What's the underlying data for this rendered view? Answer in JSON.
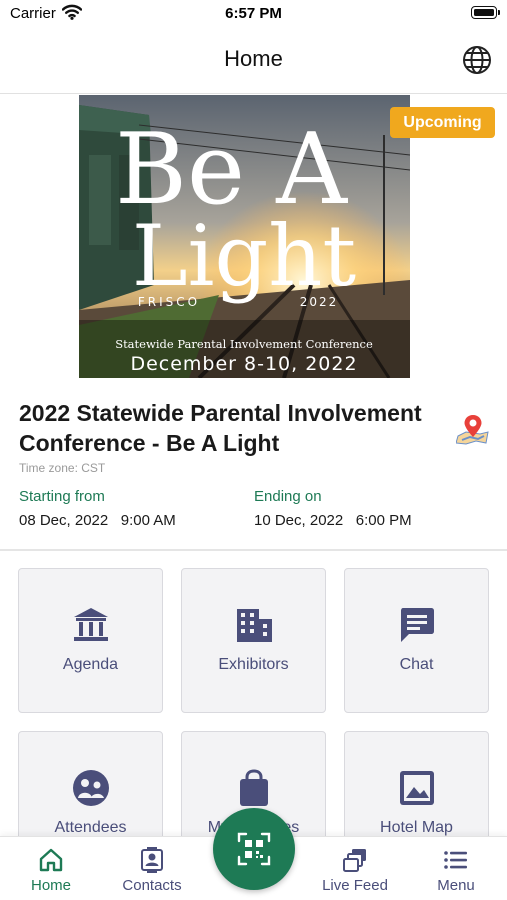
{
  "status_bar": {
    "carrier": "Carrier",
    "time": "6:57 PM"
  },
  "nav": {
    "title": "Home",
    "globe_icon": "globe-icon"
  },
  "banner": {
    "word1": "Be A",
    "word2": "Light",
    "city": "FRISCO",
    "year": "2022",
    "subtitle": "Statewide Parental Involvement Conference",
    "dates": "December 8-10, 2022"
  },
  "badge": "Upcoming",
  "event": {
    "title": "2022 Statewide Parental Involvement Conference - Be A Light",
    "timezone": "Time zone: CST",
    "start_label": "Starting from",
    "start_value": "08 Dec, 2022   9:00 AM",
    "end_label": "Ending on",
    "end_value": "10 Dec, 2022   6:00 PM"
  },
  "tiles": [
    {
      "label": "Agenda",
      "icon": "bank-icon"
    },
    {
      "label": "Exhibitors",
      "icon": "building-icon"
    },
    {
      "label": "Chat",
      "icon": "chat-icon"
    },
    {
      "label": "Attendees",
      "icon": "attendees-icon"
    },
    {
      "label": "My Favorites",
      "icon": "bag-icon"
    },
    {
      "label": "Hotel Map",
      "icon": "image-icon"
    }
  ],
  "tabs": [
    {
      "label": "Home",
      "icon": "home-icon"
    },
    {
      "label": "Contacts",
      "icon": "contacts-icon"
    },
    {
      "label": "Live Feed",
      "icon": "live-feed-icon"
    },
    {
      "label": "Menu",
      "icon": "menu-icon"
    }
  ],
  "scan_button": {
    "icon": "qr-scan-icon"
  },
  "colors": {
    "accent_green": "#1e7a55",
    "badge_orange": "#f0a81e",
    "icon_navy": "#4a4e7a",
    "tile_bg": "#f3f3f5"
  }
}
